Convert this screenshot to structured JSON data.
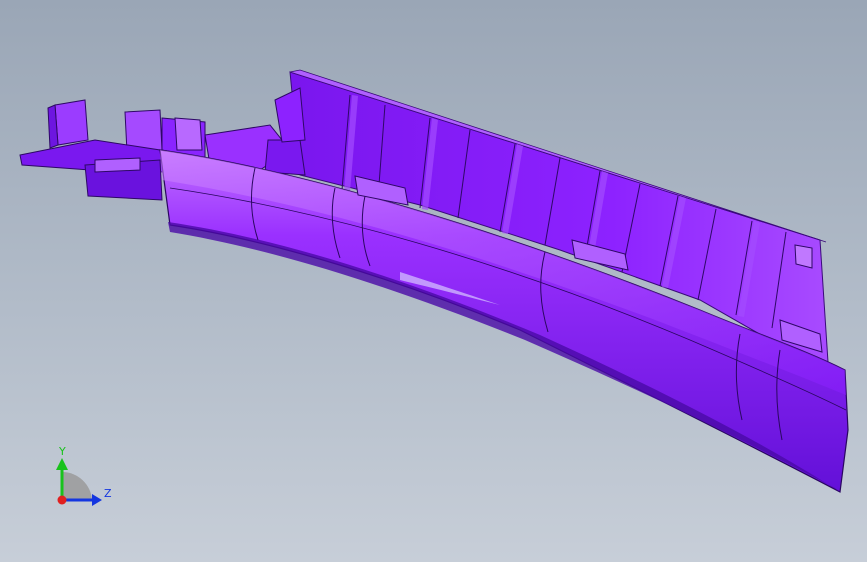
{
  "viewport": {
    "background_top": "#9aa6b6",
    "background_bottom": "#c7ced8",
    "model_color": "#8a1dff"
  },
  "triad": {
    "y_label": "Y",
    "z_label": "Z",
    "y_color": "#19c21c",
    "z_color": "#1436e0",
    "x_color": "#e02020"
  }
}
